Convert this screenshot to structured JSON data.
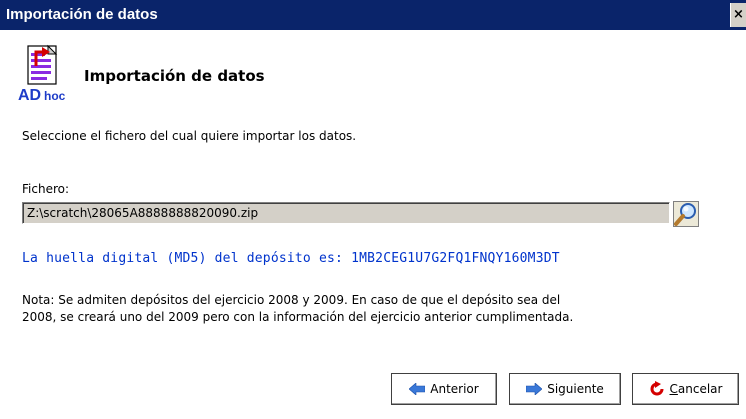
{
  "window": {
    "title": "Importación de datos",
    "close_glyph": "×"
  },
  "header": {
    "icon": "adhoc-import-icon",
    "icon_text": "ADhoc",
    "title": "Importación de datos"
  },
  "instruction": "Seleccione el fichero del cual quiere importar los datos.",
  "file": {
    "label": "Fichero:",
    "value": "Z:\\scratch\\28065A8888888820090.zip",
    "browse_icon": "magnifier-icon"
  },
  "md5_text": "La huella digital (MD5) del depósito es: 1MB2CEG1U7G2FQ1FNQY160M3DT",
  "note": {
    "line1": "Nota: Se admiten depósitos del ejercicio 2008 y 2009. En caso de que el depósito sea del",
    "line2": "2008, se creará uno del 2009 pero con la información del ejercicio anterior cumplimentada."
  },
  "buttons": {
    "previous": "Anterior",
    "next": "Siguiente",
    "cancel": "Cancelar"
  },
  "colors": {
    "titlebar": "#0a246a",
    "md5_text": "#0033cc",
    "input_bg": "#d4d0c8"
  }
}
